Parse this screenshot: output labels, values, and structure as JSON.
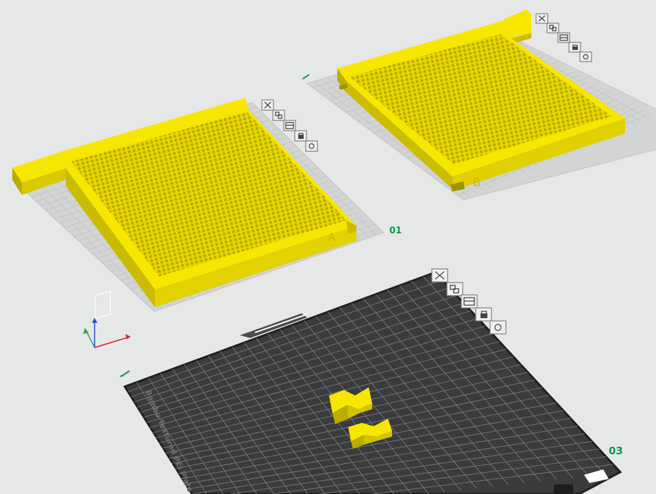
{
  "app": {
    "name": "slicer-prepare-view"
  },
  "colors": {
    "background": "#e6e7e7",
    "model_yellow": "#f7e600",
    "model_shadow": "#b9ad00",
    "plate_dark": "#3a3b3c",
    "plate_grid": "#8b8d8f",
    "plate_label_green": "#0a9a4a",
    "grid_light": "#d2d3d3"
  },
  "plates": [
    {
      "id": "plate-01",
      "number_label": "01",
      "part_marker": "A",
      "edit_icon": "pencil-icon"
    },
    {
      "id": "plate-02",
      "number_label": "",
      "part_marker": "B",
      "edit_icon": "pencil-icon"
    },
    {
      "id": "plate-03",
      "number_label": "03",
      "bed_text": "Bambu Textured PEI Plate",
      "edit_icon": "pencil-icon"
    }
  ],
  "plate_toolbar": [
    {
      "name": "delete-plate-icon",
      "label": "Delete plate"
    },
    {
      "name": "arrange-plate-icon",
      "label": "Arrange"
    },
    {
      "name": "orient-plate-icon",
      "label": "Auto orient"
    },
    {
      "name": "lock-plate-icon",
      "label": "Lock plate"
    },
    {
      "name": "plate-settings-icon",
      "label": "Plate settings"
    }
  ],
  "axes": {
    "x_color": "#d21f2a",
    "y_color": "#2aa84a",
    "z_color": "#2a54c8"
  }
}
